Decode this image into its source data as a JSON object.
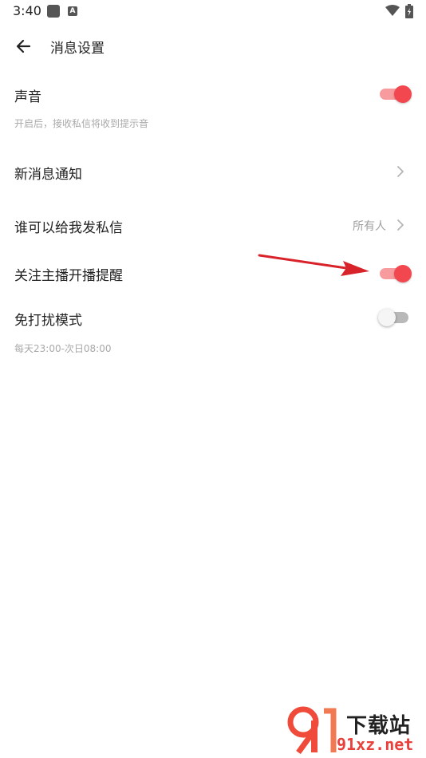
{
  "status_bar": {
    "time": "3:40",
    "notification_letter": "A"
  },
  "header": {
    "title": "消息设置"
  },
  "settings": [
    {
      "label": "声音",
      "description": "开启后，接收私信将收到提示音",
      "toggle": true
    },
    {
      "label": "新消息通知"
    },
    {
      "label": "谁可以给我发私信",
      "value": "所有人"
    },
    {
      "label": "关注主播开播提醒",
      "toggle": true
    },
    {
      "label": "免打扰模式",
      "description": "每天23:00-次日08:00",
      "toggle": false
    }
  ],
  "watermark": {
    "mark": "91",
    "title": "下载站",
    "domain": "91xz.net"
  },
  "colors": {
    "accent": "#f2474f",
    "accent_track": "#f79b9f",
    "arrow": "#d9232a",
    "secondary_text": "#a9a9a9"
  }
}
